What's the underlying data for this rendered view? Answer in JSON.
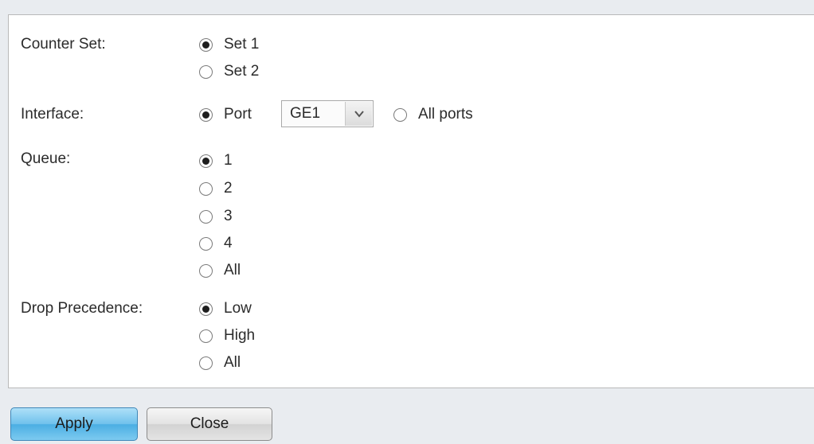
{
  "form": {
    "counter_set": {
      "label": "Counter Set:",
      "options": [
        "Set 1",
        "Set 2"
      ],
      "selected": "Set 1"
    },
    "interface": {
      "label": "Interface:",
      "port_label": "Port",
      "port_value": "GE1",
      "all_ports_label": "All ports",
      "selected": "Port"
    },
    "queue": {
      "label": "Queue:",
      "options": [
        "1",
        "2",
        "3",
        "4",
        "All"
      ],
      "selected": "1"
    },
    "drop_precedence": {
      "label": "Drop Precedence:",
      "options": [
        "Low",
        "High",
        "All"
      ],
      "selected": "Low"
    }
  },
  "buttons": {
    "apply": "Apply",
    "close": "Close"
  },
  "icons": {
    "select_arrow": "chevron-down-icon"
  },
  "colors": {
    "apply_button": "#6fc1ec",
    "panel_border": "#b9b9b9",
    "background": "#e9ecf0"
  }
}
